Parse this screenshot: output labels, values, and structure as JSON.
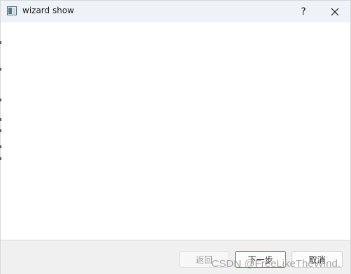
{
  "window": {
    "title": "wizard show",
    "help_label": "?",
    "icons": {
      "app": "app-window-icon",
      "close": "close-icon"
    }
  },
  "buttons": {
    "back_label": "返回",
    "next_label": "下一步",
    "cancel_label": "取消"
  },
  "watermark": "CSDN @FreeLikeTheWind."
}
